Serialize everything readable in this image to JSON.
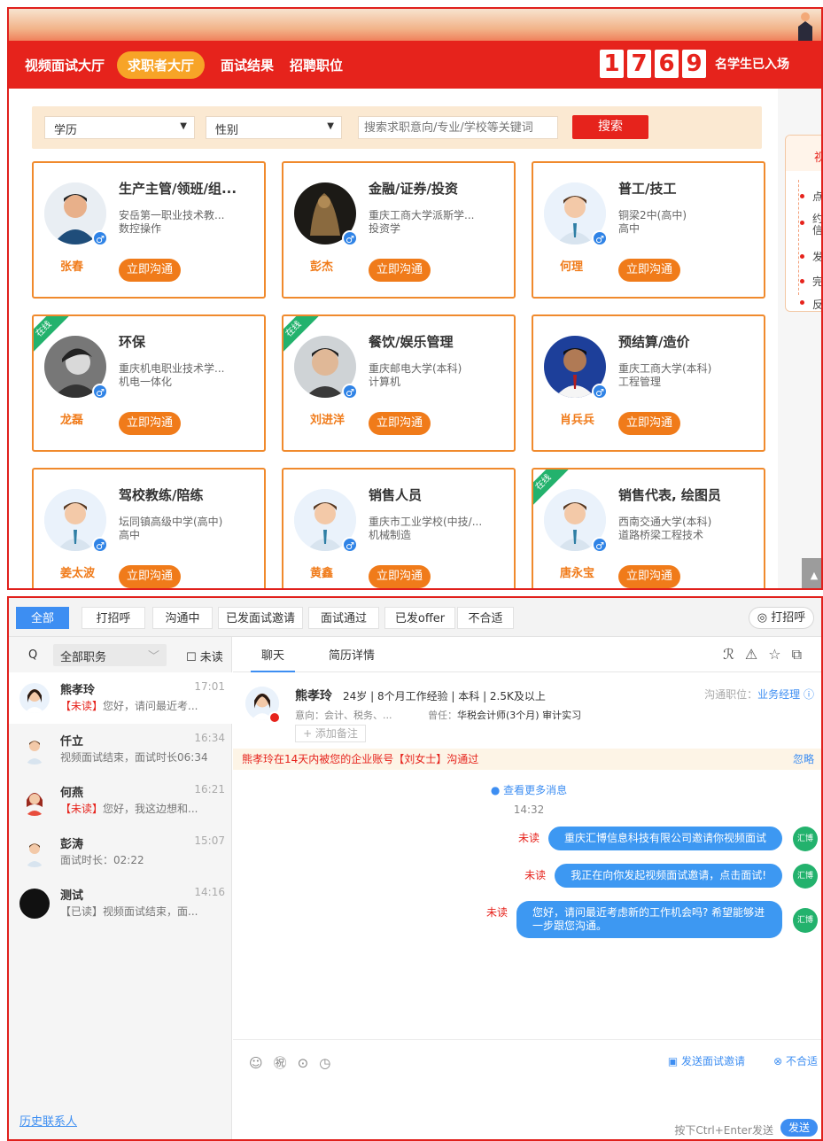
{
  "top": {
    "nav": [
      "视频面试大厅",
      "求职者大厅",
      "面试结果",
      "招聘职位"
    ],
    "active_nav": "求职者大厅",
    "counter_digits": [
      "1",
      "7",
      "6",
      "9"
    ],
    "counter_label": "名学生已入场",
    "filter": {
      "education_label": "学历",
      "gender_label": "性别",
      "search_placeholder": "搜索求职意向/专业/学校等关键词",
      "search_button": "搜索"
    },
    "side_panel": {
      "title": "视",
      "items": [
        "点",
        "约信",
        "发",
        "完",
        "反"
      ]
    },
    "cards": [
      {
        "title": "生产主管/领班/组...",
        "school": "安岳第一职业技术教...",
        "major": "数控操作",
        "name": "张春",
        "online": false,
        "online_label": "",
        "button": "立即沟通"
      },
      {
        "title": "金融/证券/投资",
        "school": "重庆工商大学派斯学...",
        "major": "投资学",
        "name": "彭杰",
        "online": false,
        "online_label": "",
        "button": "立即沟通"
      },
      {
        "title": "普工/技工",
        "school": "铜梁2中(高中)",
        "major": "高中",
        "name": "何理",
        "online": false,
        "online_label": "",
        "button": "立即沟通"
      },
      {
        "title": "环保",
        "school": "重庆机电职业技术学...",
        "major": "机电一体化",
        "name": "龙磊",
        "online": true,
        "online_label": "在线",
        "button": "立即沟通"
      },
      {
        "title": "餐饮/娱乐管理",
        "school": "重庆邮电大学(本科)",
        "major": "计算机",
        "name": "刘进洋",
        "online": true,
        "online_label": "在线",
        "button": "立即沟通"
      },
      {
        "title": "预结算/造价",
        "school": "重庆工商大学(本科)",
        "major": "工程管理",
        "name": "肖兵兵",
        "online": false,
        "online_label": "",
        "button": "立即沟通"
      },
      {
        "title": "驾校教练/陪练",
        "school": "坛同镇高级中学(高中)",
        "major": "高中",
        "name": "姜太波",
        "online": false,
        "online_label": "",
        "button": "立即沟通"
      },
      {
        "title": "销售人员",
        "school": "重庆市工业学校(中技/...",
        "major": "机械制造",
        "name": "黄鑫",
        "online": false,
        "online_label": "",
        "button": "立即沟通"
      },
      {
        "title": "销售代表, 绘图员",
        "school": "西南交通大学(本科)",
        "major": "道路桥梁工程技术",
        "name": "唐永宝",
        "online": true,
        "online_label": "在线",
        "button": "立即沟通"
      }
    ]
  },
  "bottom": {
    "stages": [
      "全部",
      "打招呼",
      "沟通中",
      "已发面试邀请",
      "面试通过",
      "已发offer",
      "不合适"
    ],
    "greet_button": "◎ 打招呼",
    "left": {
      "search_icon": "Q",
      "job_select": "全部职务",
      "unread_filter": "☐ 未读",
      "conversations": [
        {
          "name": "熊孝玲",
          "time": "17:01",
          "tag": "【未读】",
          "msg": "您好，请问最近考...",
          "active": true
        },
        {
          "name": "仟立",
          "time": "16:34",
          "tag": "",
          "msg": "视频面试结束，面试时长06:34",
          "active": false
        },
        {
          "name": "何燕",
          "time": "16:21",
          "tag": "【未读】",
          "msg": "您好，我这边想和...",
          "active": false
        },
        {
          "name": "彭涛",
          "time": "15:07",
          "tag": "",
          "msg": "面试时长：02:22",
          "active": false
        },
        {
          "name": "测试",
          "time": "14:16",
          "tag": "",
          "msg": "【已读】视频面试结束，面...",
          "active": false
        }
      ],
      "history_link": "历史联系人"
    },
    "chat": {
      "tabs": [
        "聊天",
        "简历详情"
      ],
      "header_icons": [
        "ℛ",
        "⚠",
        "☆",
        "⧉"
      ],
      "profile": {
        "name": "熊孝玲",
        "info": "24岁 | 8个月工作经验 | 本科 | 2.5K及以上",
        "intent": "意向：会计、税务、...",
        "former_label": "曾任：",
        "former_value": "华税会计师(3个月) 审计实习",
        "note_button": "+ 添加备注",
        "position_label": "沟通职位：",
        "position_value": "业务经理"
      },
      "notice": "熊孝玲在14天内被您的企业账号【刘女士】沟通过",
      "ignore": "忽略",
      "more": "● 查看更多消息",
      "timestamp": "14:32",
      "messages": [
        {
          "status": "未读",
          "text": "重庆汇博信息科技有限公司邀请你视频面试"
        },
        {
          "status": "未读",
          "text": "我正在向你发起视频面试邀请，点击面试!"
        },
        {
          "status": "未读",
          "text": "您好，请问最近考虑新的工作机会吗? 希望能够进一步跟您沟通。"
        }
      ],
      "avatar_label": "汇博",
      "tool_icons": [
        "☺",
        "㊗",
        "⊙",
        "◷"
      ],
      "invite": "发送面试邀请",
      "reject": "⊗ 不合适",
      "send_hint": "按下Ctrl+Enter发送",
      "send_button": "发送"
    }
  },
  "colors": {
    "brand_red": "#e6231c",
    "orange": "#f07b1a",
    "blue": "#3d8ef2",
    "green": "#23b26d"
  }
}
